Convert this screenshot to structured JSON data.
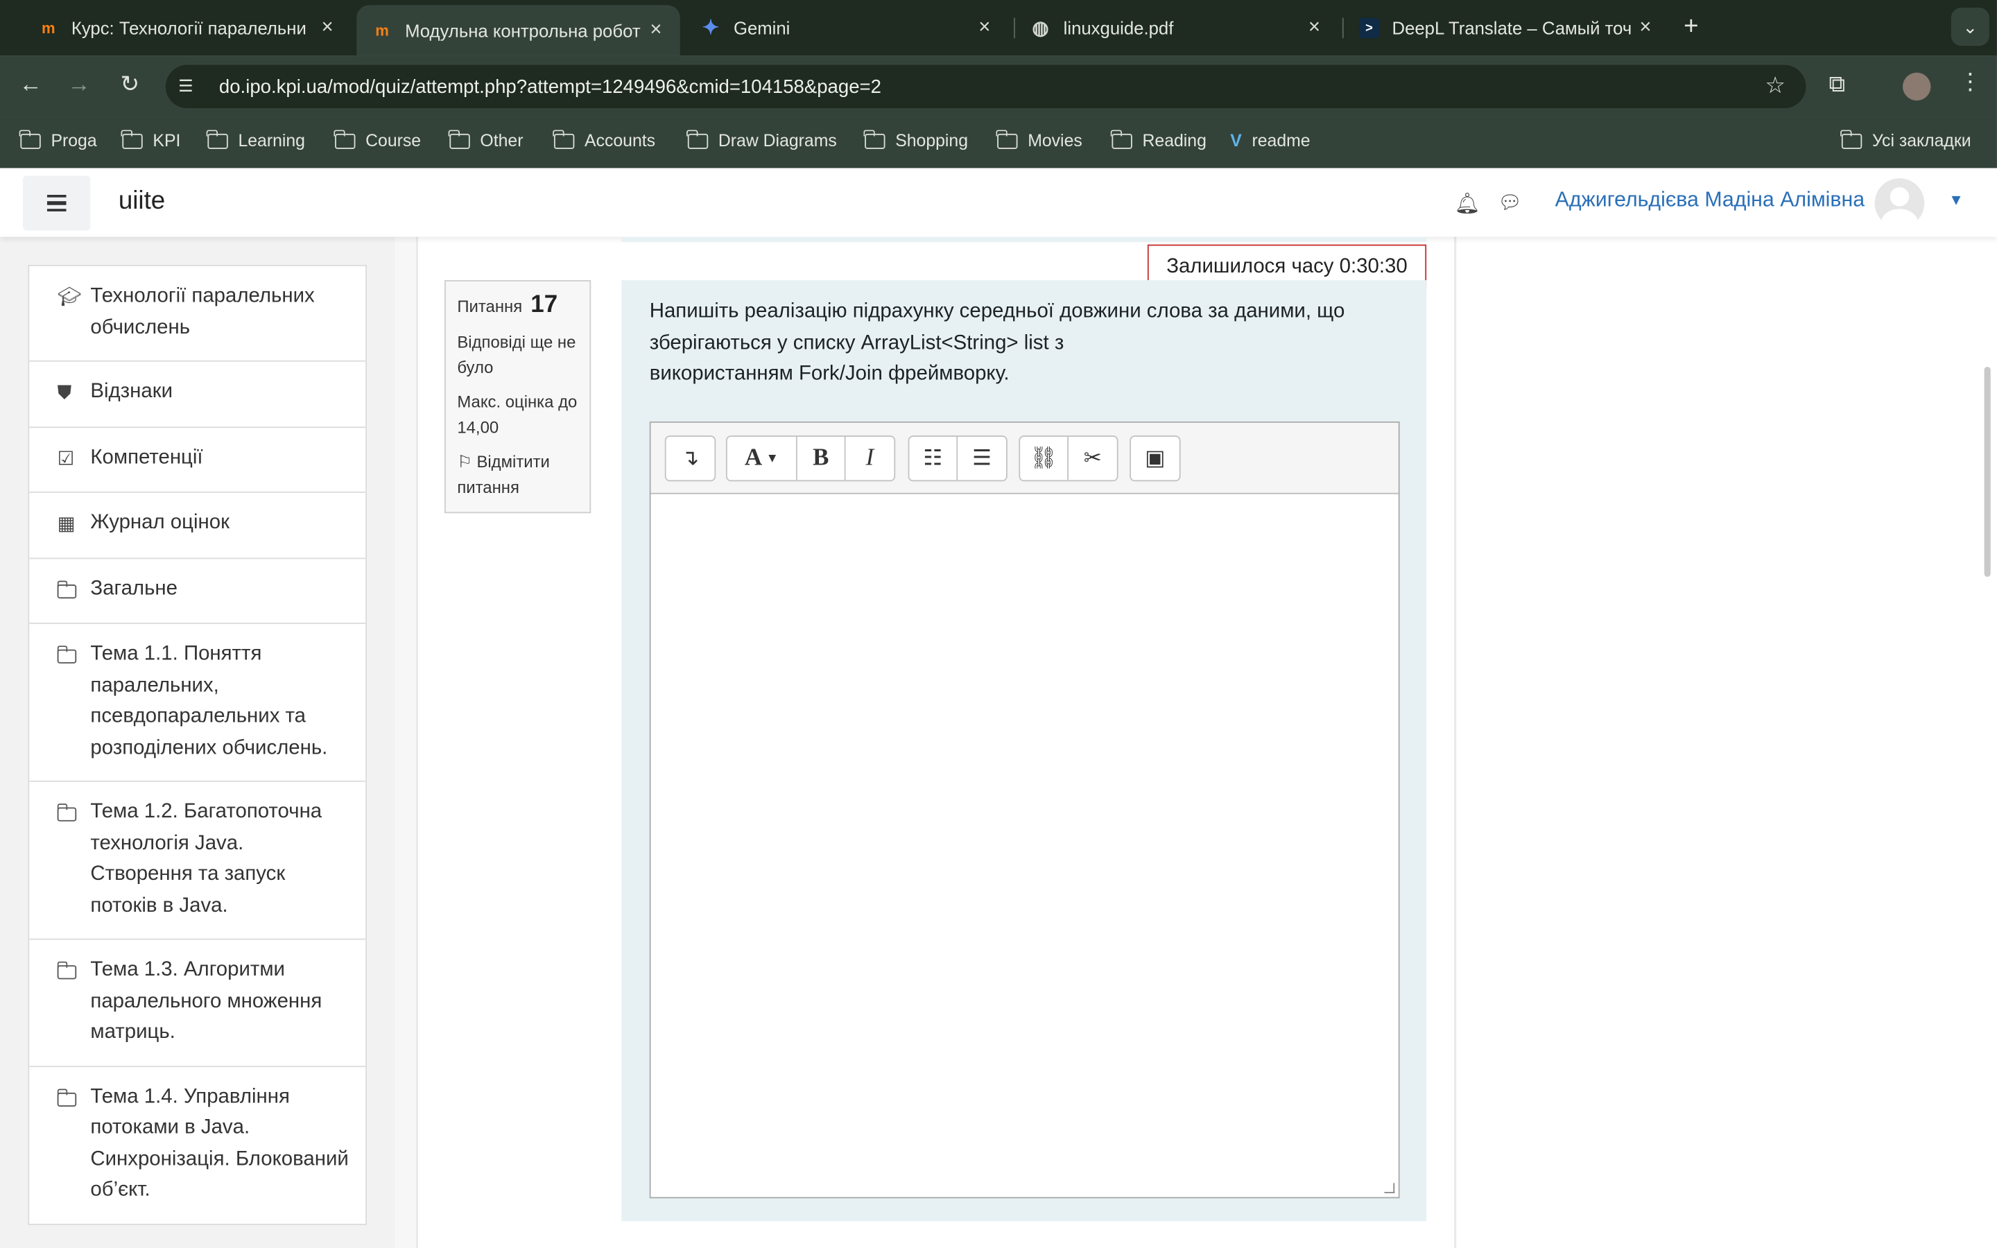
{
  "browser": {
    "tabs": [
      {
        "label": "Курс: Технології паралельни",
        "icon": "moodle-icon",
        "active": false
      },
      {
        "label": "Модульна контрольна робот",
        "icon": "moodle-icon",
        "active": true
      },
      {
        "label": "Gemini",
        "icon": "gemini-icon",
        "active": false
      },
      {
        "label": "linuxguide.pdf",
        "icon": "globe-icon",
        "active": false
      },
      {
        "label": "DeepL Translate – Самый точ",
        "icon": "deepl-icon",
        "active": false
      }
    ],
    "url": "do.ipo.kpi.ua/mod/quiz/attempt.php?attempt=1249496&cmid=104158&page=2",
    "bookmarks": [
      "Proga",
      "KPI",
      "Learning",
      "Course",
      "Other",
      "Accounts",
      "Draw Diagrams",
      "Shopping",
      "Movies",
      "Reading",
      "readme"
    ],
    "all_bookmarks": "Усі закладки"
  },
  "header": {
    "site_name": "uiite",
    "user_name": "Аджигельдієва Мадіна Алімівна"
  },
  "nav": {
    "items": [
      {
        "label": "Технології паралельних обчислень",
        "icon": "graduation-cap-icon"
      },
      {
        "label": "Відзнаки",
        "icon": "shield-icon"
      },
      {
        "label": "Компетенції",
        "icon": "checkbox-icon"
      },
      {
        "label": "Журнал оцінок",
        "icon": "table-icon"
      },
      {
        "label": "Загальне",
        "icon": "folder-icon"
      },
      {
        "label": "Тема 1.1. Поняття паралельних, псевдопаралельних та розподілених обчислень.",
        "icon": "folder-icon"
      },
      {
        "label": "Тема 1.2. Багатопоточна технологія Java. Створення та запуск потоків в Java.",
        "icon": "folder-icon"
      },
      {
        "label": "Тема 1.3. Алгоритми паралельного множення матриць.",
        "icon": "folder-icon"
      },
      {
        "label": "Тема 1.4. Управління потоками в Java. Синхронізація. Блокований об’єкт.",
        "icon": "folder-icon"
      }
    ]
  },
  "quiz": {
    "timer": "Залишилося часу 0:30:30",
    "question_label": "Питання",
    "question_number": "17",
    "status": "Відповіді ще не було",
    "max_grade": "Макс. оцінка до 14,00",
    "flag_label": "Відмітити питання",
    "question_text_line1": "Напишіть реалізацію підрахунку середньої довжини слова за даними, що",
    "question_text_line2": "зберігаються у списку ArrayList<String> list з",
    "question_text_line3": "використанням Fork/Join фреймворку.",
    "answer_value": ""
  },
  "editor_toolbar": [
    "toggle-toolbar",
    "font-style",
    "bold",
    "italic",
    "bullet-list",
    "numbered-list",
    "link",
    "unlink",
    "image"
  ]
}
